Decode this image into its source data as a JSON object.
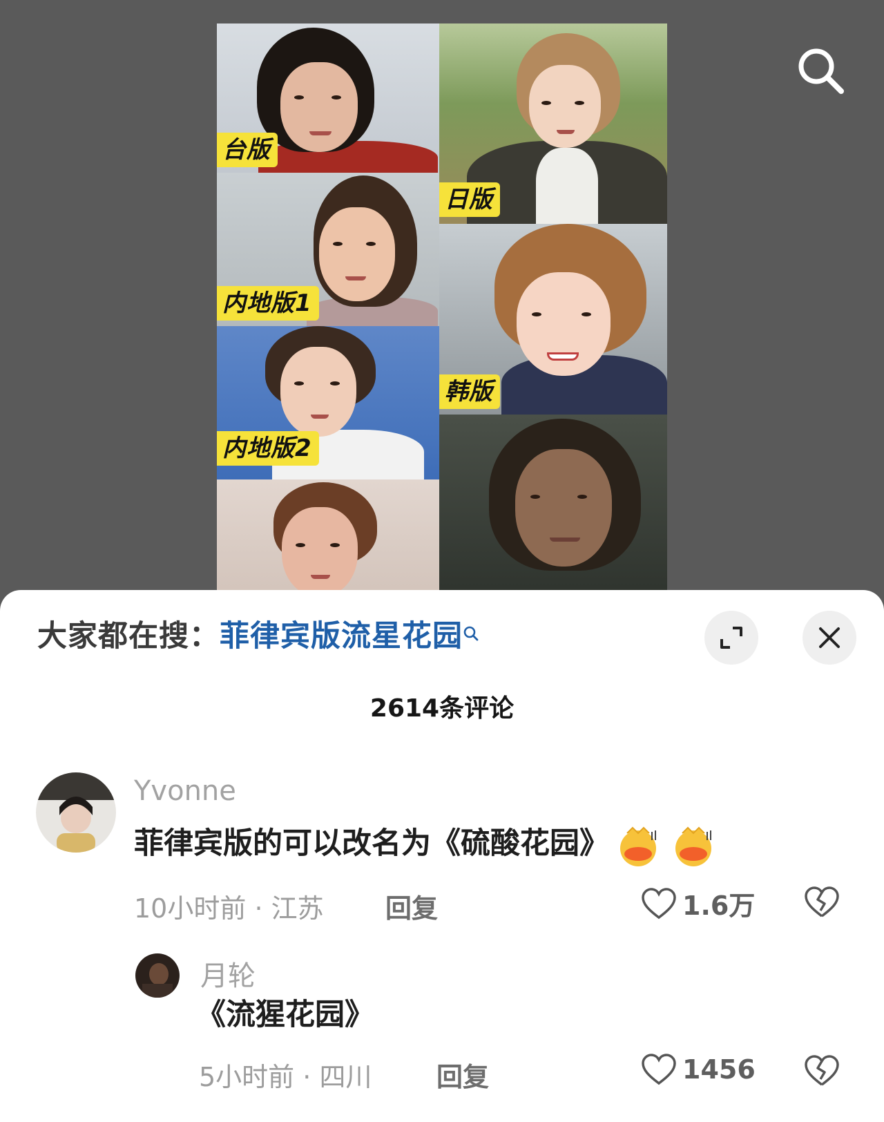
{
  "video": {
    "labels": [
      "台版",
      "日版",
      "内地版1",
      "韩版",
      "内地版2"
    ]
  },
  "search_bar": {
    "prefix": "大家都在搜：",
    "query": "菲律宾版流星花园"
  },
  "comments_count": "2614条评论",
  "comments": [
    {
      "username": "Yvonne",
      "text": "菲律宾版的可以改名为《硫酸花园》",
      "time": "10小时前",
      "location": "江苏",
      "reply_label": "回复",
      "likes": "1.6万"
    },
    {
      "username": "月轮",
      "text": "《流猩花园》",
      "time": "5小时前",
      "location": "四川",
      "reply_label": "回复",
      "likes": "1456"
    }
  ],
  "colors": {
    "link": "#1f5fa8",
    "label_bg": "#f6e23a"
  },
  "icons": [
    "search-icon",
    "expand-icon",
    "close-icon",
    "heart-icon",
    "broken-heart-icon",
    "magnifier-small-icon"
  ]
}
